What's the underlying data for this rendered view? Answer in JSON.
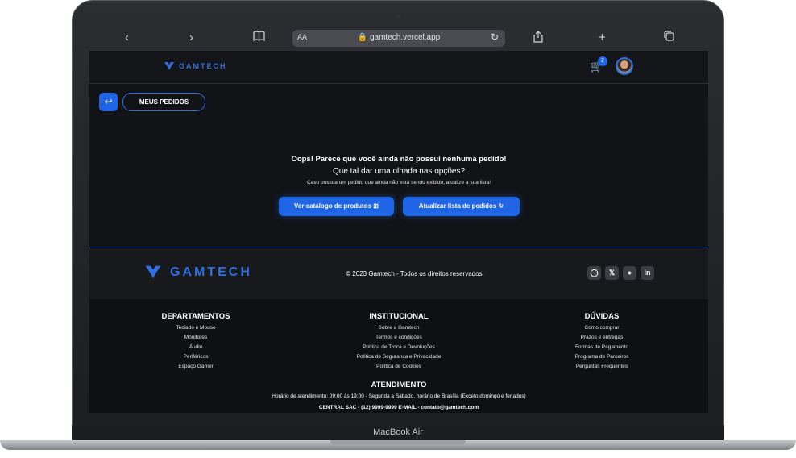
{
  "device": {
    "label": "MacBook Air"
  },
  "browser": {
    "text_size_label": "AA",
    "url": "gamtech.vercel.app",
    "icons": [
      "back-icon",
      "forward-icon",
      "bookmarks-icon",
      "lock-icon",
      "reload-icon",
      "share-icon",
      "new-tab-icon",
      "tabs-icon"
    ]
  },
  "navbar": {
    "logo_text": "GAMTECH",
    "cart_count": "2"
  },
  "page": {
    "title": "MEUS PEDIDOS",
    "empty_title": "Oops! Parece que você ainda não possui nenhuma pedido!",
    "empty_subtitle": "Que tal dar uma olhada nas opções?",
    "empty_hint": "Caso possua um pedido que ainda não está sendo exibido, atualize a sua lista!",
    "catalog_button": "Ver catálogo de produtos",
    "refresh_button": "Atualizar lista de pedidos"
  },
  "footer": {
    "logo_text": "GAMTECH",
    "copyright": "© 2023 Gamtech - Todos os direitos reservados.",
    "social": [
      "instagram-icon",
      "x-icon",
      "github-icon",
      "linkedin-icon"
    ],
    "departamentos": {
      "title": "DEPARTAMENTOS",
      "items": [
        "Teclado e Mouse",
        "Monitores",
        "Áudio",
        "Periféricos",
        "Espaço Gamer"
      ]
    },
    "institucional": {
      "title": "INSTITUCIONAL",
      "items": [
        "Sobre a Gamtech",
        "Termos e condições",
        "Política de Troca e Devoluções",
        "Política de Segurança e Privacidade",
        "Política de Cookies"
      ]
    },
    "duvidas": {
      "title": "DÚVIDAS",
      "items": [
        "Como comprar",
        "Prazos e entregas",
        "Formas de Pagamento",
        "Programa de Parceiros",
        "Perguntas Frequentes"
      ]
    },
    "atendimento": {
      "title": "ATENDIMENTO",
      "hours": "Horário de atendimento: 09:00 às 19:00 - Segunda a Sábado, horário de Brasília (Exceto domingo e feriados)",
      "contact": "CENTRAL SAC - (12) 9999-9999 E-MAIL - contato@gamtech.com"
    }
  },
  "colors": {
    "accent": "#1e66e6",
    "background": "#121316"
  }
}
